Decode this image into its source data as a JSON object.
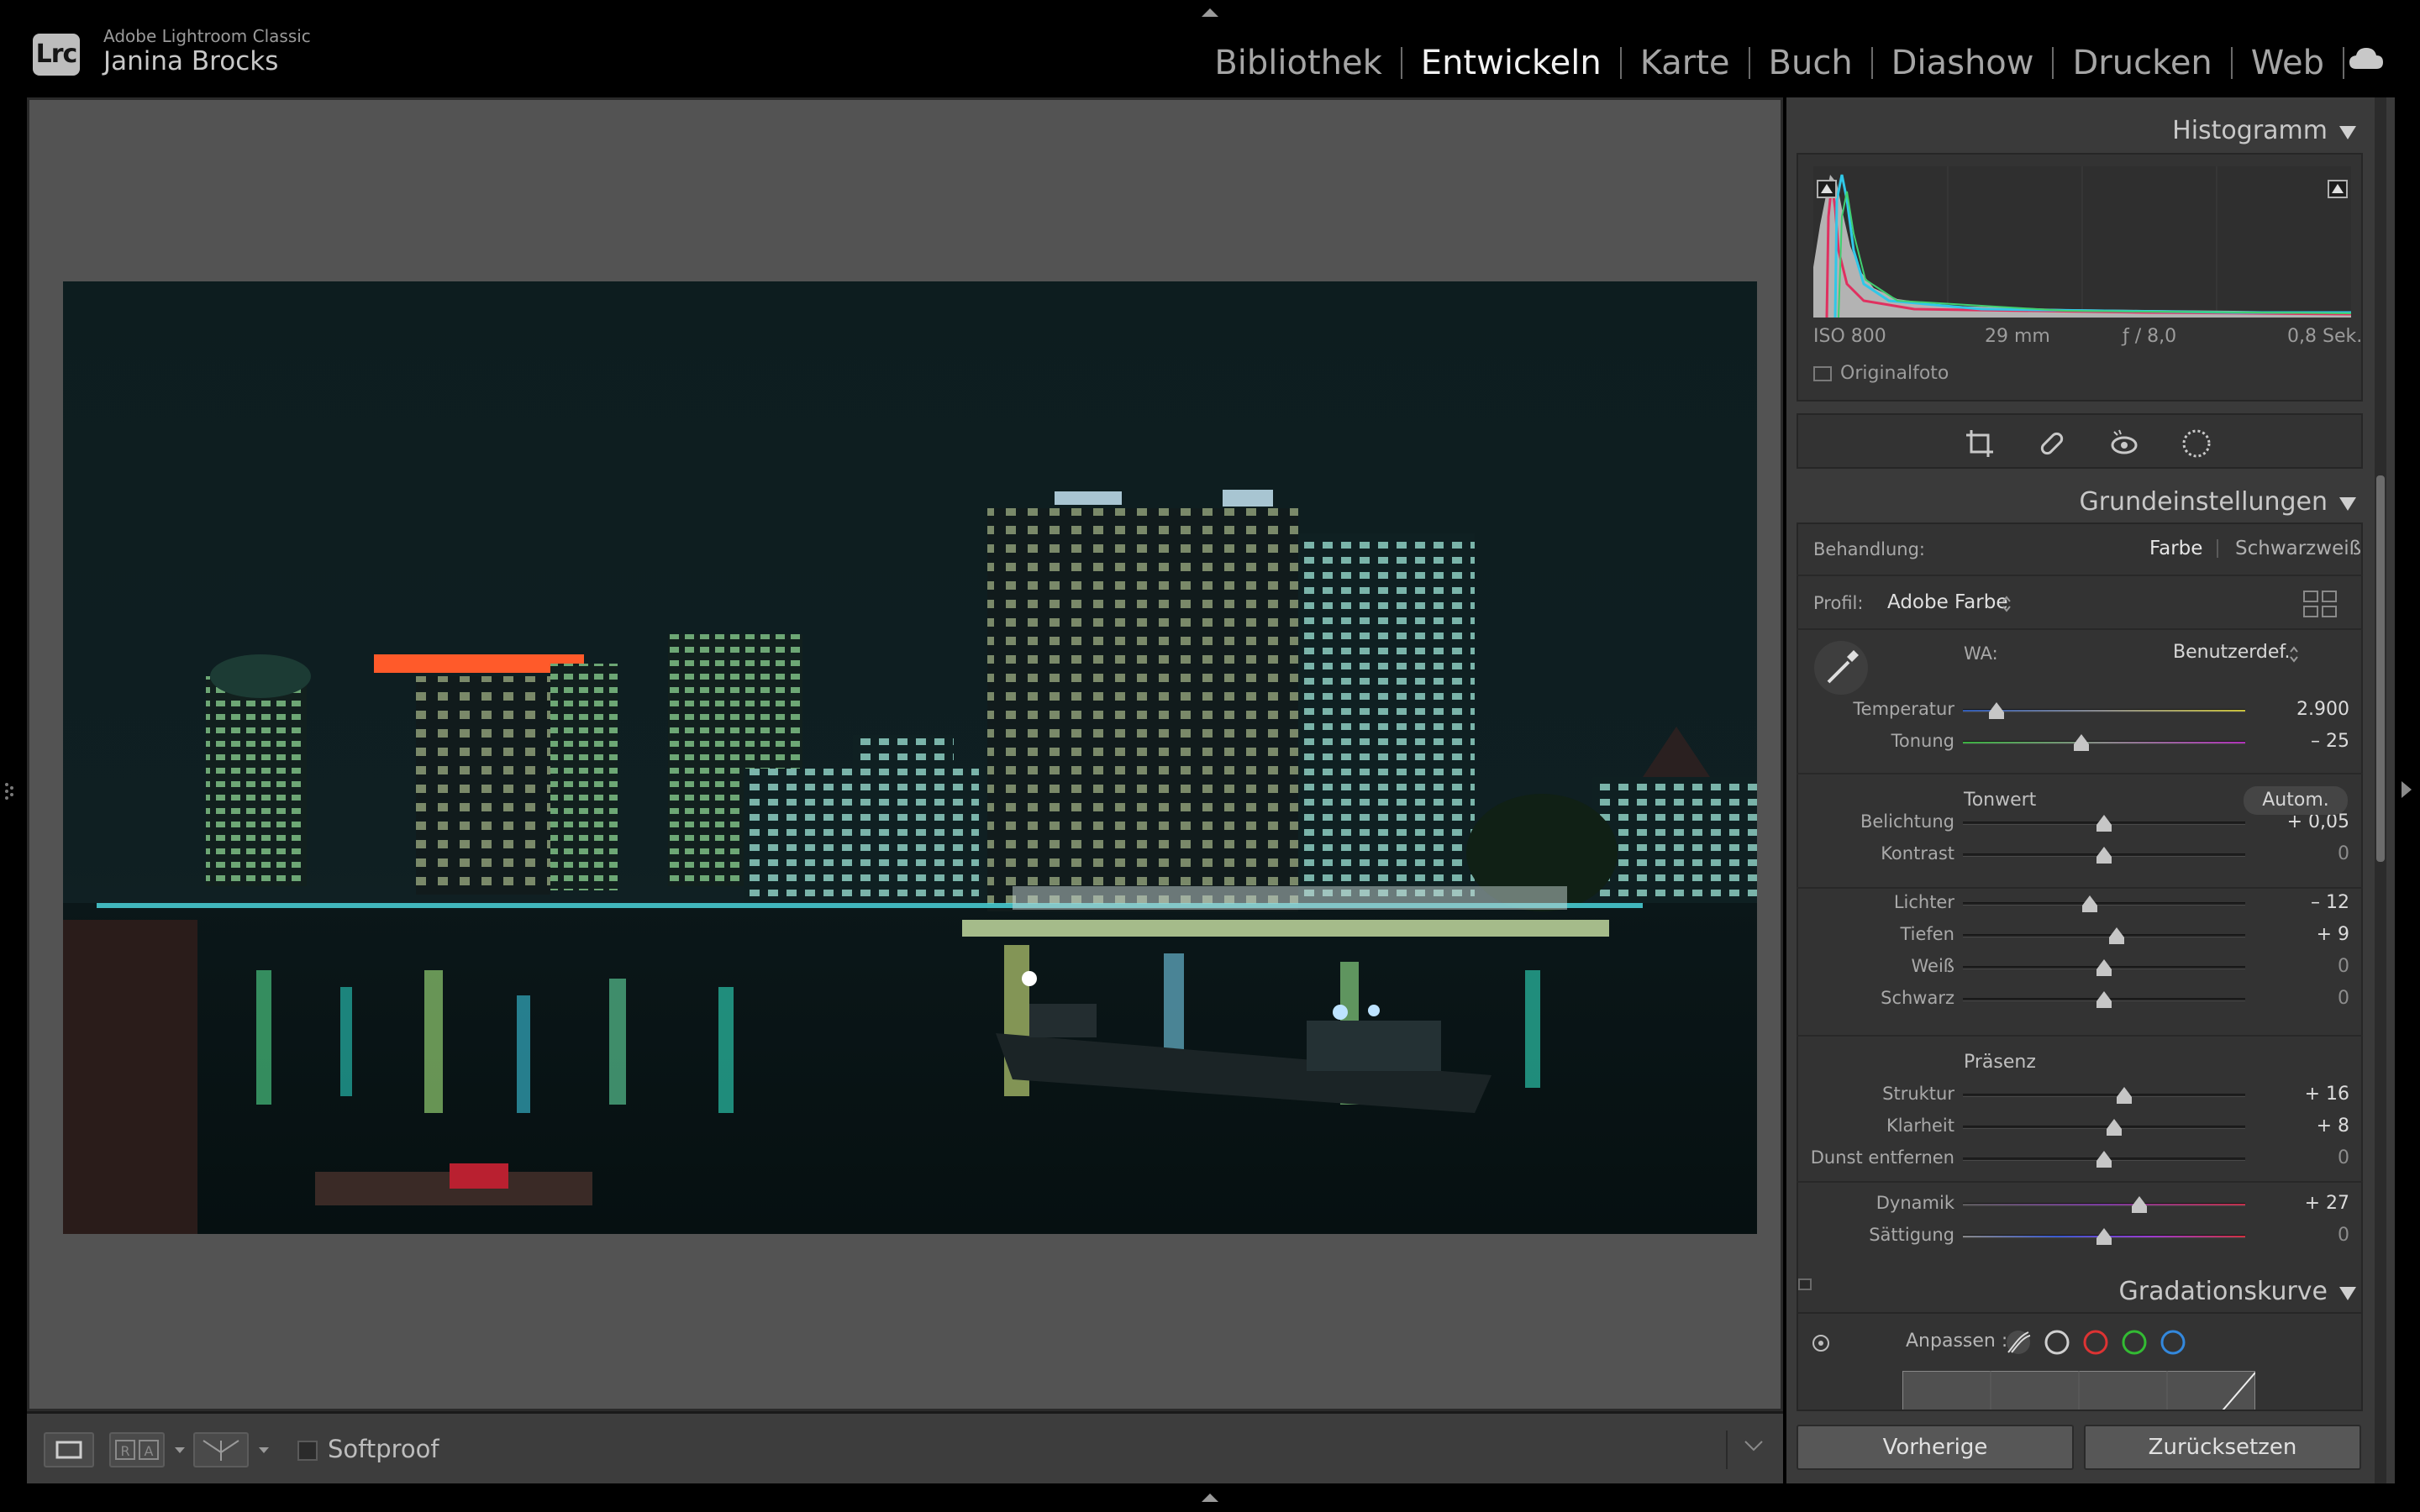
{
  "app": {
    "logo": "Lrc",
    "name": "Adobe Lightroom Classic",
    "user": "Janina Brocks"
  },
  "modules": [
    "Bibliothek",
    "Entwickeln",
    "Karte",
    "Buch",
    "Diashow",
    "Drucken",
    "Web"
  ],
  "active_module": "Entwickeln",
  "toolbar": {
    "softproof_label": "Softproof",
    "compare_label": "R|A"
  },
  "histogram": {
    "title": "Histogramm",
    "iso": "ISO 800",
    "focal": "29 mm",
    "aperture": "ƒ / 8,0",
    "shutter": "0,8 Sek.",
    "original_label": "Originalfoto"
  },
  "basic": {
    "title": "Grundeinstellungen",
    "treatment_label": "Behandlung:",
    "treatment_color": "Farbe",
    "treatment_bw": "Schwarzweiß",
    "profile_label": "Profil:",
    "profile_value": "Adobe Farbe",
    "wb_label": "WA:",
    "wb_value": "Benutzerdef.",
    "tone_label": "Tonwert",
    "auto_label": "Autom.",
    "presence_label": "Präsenz",
    "sliders": [
      {
        "key": "temp",
        "label": "Temperatur",
        "value": "2.900",
        "pos": 0.12
      },
      {
        "key": "tint",
        "label": "Tonung",
        "value": "– 25",
        "pos": 0.42
      },
      {
        "key": "exp",
        "label": "Belichtung",
        "value": "+ 0,05",
        "pos": 0.5
      },
      {
        "key": "con",
        "label": "Kontrast",
        "value": "0",
        "pos": 0.5
      },
      {
        "key": "hi",
        "label": "Lichter",
        "value": "– 12",
        "pos": 0.45
      },
      {
        "key": "sh",
        "label": "Tiefen",
        "value": "+ 9",
        "pos": 0.545
      },
      {
        "key": "wh",
        "label": "Weiß",
        "value": "0",
        "pos": 0.5
      },
      {
        "key": "bl",
        "label": "Schwarz",
        "value": "0",
        "pos": 0.5
      },
      {
        "key": "tex",
        "label": "Struktur",
        "value": "+ 16",
        "pos": 0.57
      },
      {
        "key": "cla",
        "label": "Klarheit",
        "value": "+ 8",
        "pos": 0.535
      },
      {
        "key": "dh",
        "label": "Dunst entfernen",
        "value": "0",
        "pos": 0.5
      },
      {
        "key": "vib",
        "label": "Dynamik",
        "value": "+ 27",
        "pos": 0.625
      },
      {
        "key": "sat",
        "label": "Sättigung",
        "value": "0",
        "pos": 0.5
      }
    ]
  },
  "curve": {
    "title": "Gradationskurve",
    "adjust_label": "Anpassen :"
  },
  "buttons": {
    "previous": "Vorherige",
    "reset": "Zurücksetzen"
  },
  "colors": {
    "accent_text": "#f2f2f2",
    "panel_bg": "#3a3a3a",
    "viewer_bg": "#535353"
  }
}
